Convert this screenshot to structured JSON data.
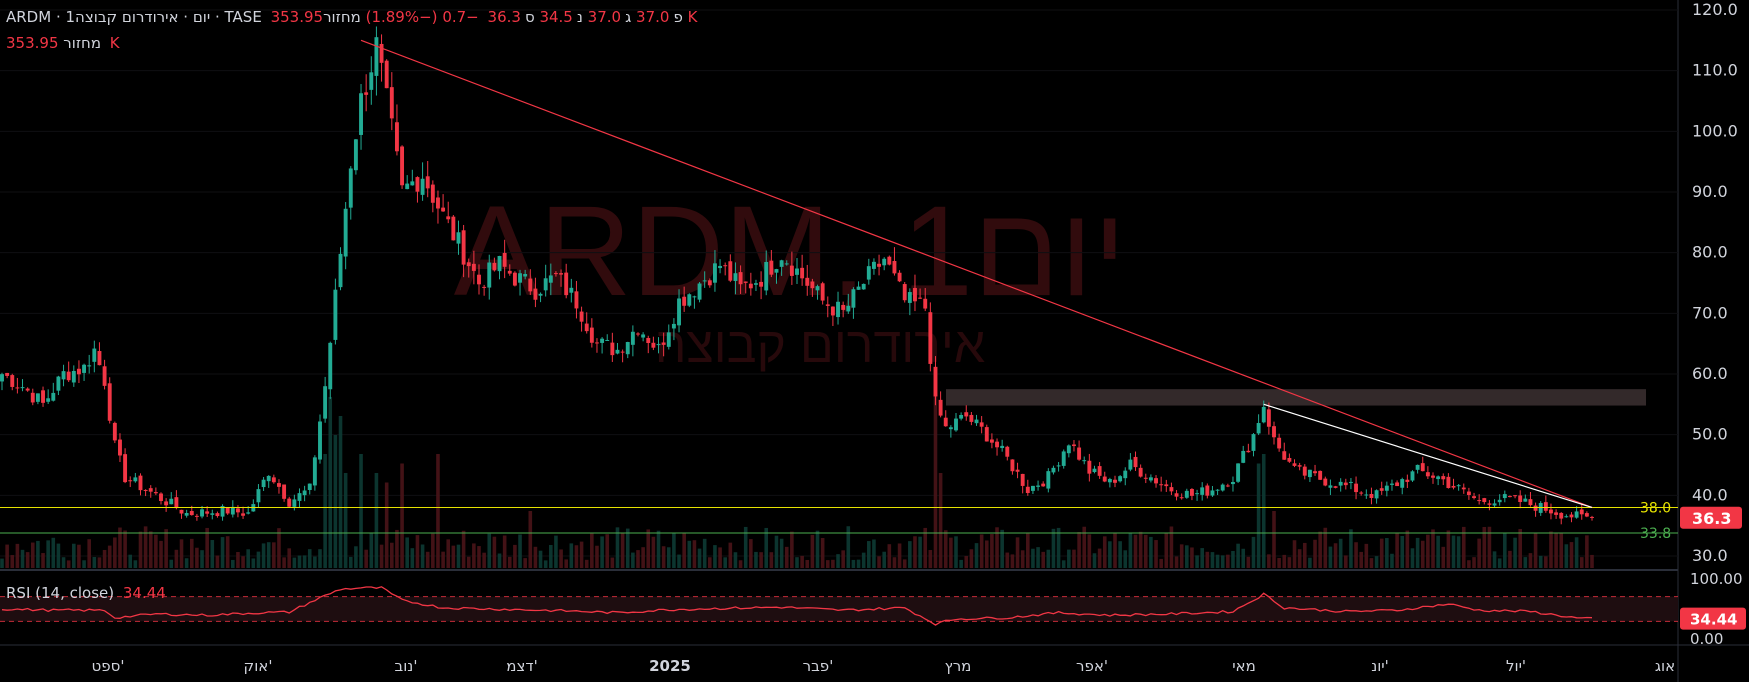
{
  "legend": {
    "symbol_text": "ARDM · 1יום · אירודרום קבוצה · TASE",
    "o_label": "פ",
    "o_value": "37.0",
    "h_label": "ג",
    "h_value": "37.0",
    "l_label": "נ",
    "l_value": "34.5",
    "c_label": "ס",
    "c_value": "36.3",
    "change": "−0.7 (−1.89%)",
    "vol_label": "מחזור",
    "vol_value": "353.95 K"
  },
  "volume_legend": {
    "label": "מחזור",
    "value": "353.95 K"
  },
  "rsi_legend": {
    "label": "RSI (14, close)",
    "value": "34.44"
  },
  "watermark": {
    "line1": "ARDM, 1יום",
    "line2": "אירודרום קבוצה"
  },
  "colors": {
    "up": "#22ab94",
    "down": "#f23645",
    "yellow_line": "#e6e300",
    "green_line": "#4caf50",
    "rsi": "#f23645"
  },
  "chart_data": {
    "type": "candlestick",
    "price_axis": {
      "min": 30,
      "max": 120,
      "ticks": [
        "120.0",
        "110.0",
        "100.0",
        "90.0",
        "80.0",
        "70.0",
        "60.0",
        "50.0",
        "40.0",
        "30.0"
      ]
    },
    "time_axis": {
      "labels": [
        "ספט'",
        "אוק'",
        "נוב'",
        "דצמ'",
        "2025",
        "פבר'",
        "מרץ",
        "אפר'",
        "מאי",
        "יונ'",
        "יול'",
        "אוג"
      ]
    },
    "horizontal_lines": [
      {
        "value": 38.0,
        "label": "38.0",
        "color": "#e6e300"
      },
      {
        "value": 33.8,
        "label": "33.8",
        "color": "#4caf50"
      }
    ],
    "last_price": {
      "value": 36.3,
      "label": "36.3"
    },
    "resistance_zone": {
      "from": 54.8,
      "to": 57.5
    },
    "trendlines": [
      {
        "from": {
          "index": 70,
          "price": 115
        },
        "to": {
          "index": 310,
          "price": 38
        }
      },
      {
        "from": {
          "index": 246,
          "price": 55
        },
        "to": {
          "index": 310,
          "price": 38
        }
      }
    ],
    "anchors": [
      [
        0,
        60
      ],
      [
        4,
        58
      ],
      [
        8,
        55
      ],
      [
        12,
        60
      ],
      [
        16,
        61
      ],
      [
        18,
        64
      ],
      [
        20,
        59
      ],
      [
        22,
        48
      ],
      [
        24,
        43
      ],
      [
        30,
        40
      ],
      [
        36,
        37
      ],
      [
        44,
        37.5
      ],
      [
        48,
        37
      ],
      [
        52,
        44
      ],
      [
        56,
        39
      ],
      [
        60,
        41
      ],
      [
        63,
        58
      ],
      [
        66,
        80
      ],
      [
        68,
        95
      ],
      [
        70,
        105
      ],
      [
        73,
        114
      ],
      [
        76,
        100
      ],
      [
        78,
        90
      ],
      [
        82,
        93
      ],
      [
        86,
        86
      ],
      [
        90,
        80
      ],
      [
        93,
        75
      ],
      [
        97,
        78
      ],
      [
        100,
        76
      ],
      [
        104,
        74
      ],
      [
        108,
        76
      ],
      [
        112,
        72
      ],
      [
        116,
        65
      ],
      [
        120,
        64
      ],
      [
        124,
        68
      ],
      [
        128,
        64
      ],
      [
        132,
        72
      ],
      [
        136,
        75
      ],
      [
        140,
        78
      ],
      [
        144,
        74
      ],
      [
        148,
        76
      ],
      [
        152,
        80
      ],
      [
        156,
        76
      ],
      [
        160,
        72
      ],
      [
        164,
        70
      ],
      [
        168,
        75
      ],
      [
        172,
        79
      ],
      [
        176,
        72
      ],
      [
        180,
        71
      ],
      [
        182,
        55
      ],
      [
        184,
        51
      ],
      [
        188,
        53
      ],
      [
        192,
        50
      ],
      [
        196,
        46
      ],
      [
        200,
        41
      ],
      [
        204,
        43
      ],
      [
        208,
        49
      ],
      [
        212,
        44
      ],
      [
        216,
        42
      ],
      [
        220,
        45
      ],
      [
        224,
        43
      ],
      [
        228,
        41
      ],
      [
        232,
        40
      ],
      [
        236,
        41
      ],
      [
        240,
        43
      ],
      [
        244,
        50
      ],
      [
        246,
        55
      ],
      [
        248,
        49
      ],
      [
        252,
        44
      ],
      [
        256,
        43
      ],
      [
        260,
        42
      ],
      [
        264,
        41
      ],
      [
        268,
        40
      ],
      [
        272,
        42
      ],
      [
        276,
        44
      ],
      [
        280,
        43
      ],
      [
        284,
        41
      ],
      [
        288,
        39
      ],
      [
        292,
        39.5
      ],
      [
        296,
        39
      ],
      [
        300,
        38
      ],
      [
        304,
        37
      ],
      [
        308,
        36.3
      ]
    ],
    "volume_spikes": [
      [
        63,
        0.6
      ],
      [
        64,
        0.9
      ],
      [
        65,
        0.7
      ],
      [
        66,
        0.8
      ],
      [
        67,
        0.5
      ],
      [
        70,
        0.6
      ],
      [
        73,
        0.5
      ],
      [
        75,
        0.45
      ],
      [
        78,
        0.55
      ],
      [
        85,
        0.6
      ],
      [
        103,
        0.3
      ],
      [
        182,
        1.0
      ],
      [
        183,
        0.5
      ],
      [
        245,
        0.55
      ],
      [
        246,
        0.6
      ],
      [
        248,
        0.3
      ]
    ],
    "rsi": {
      "axis": {
        "min": 0,
        "max": 100,
        "ticks": [
          "100.00",
          "0.00"
        ]
      },
      "upper_band": 70,
      "lower_band": 30,
      "anchors": [
        [
          0,
          50
        ],
        [
          10,
          48
        ],
        [
          20,
          48
        ],
        [
          22,
          36
        ],
        [
          30,
          42
        ],
        [
          40,
          40
        ],
        [
          50,
          44
        ],
        [
          56,
          45
        ],
        [
          62,
          68
        ],
        [
          66,
          82
        ],
        [
          70,
          84
        ],
        [
          74,
          84
        ],
        [
          78,
          64
        ],
        [
          86,
          52
        ],
        [
          96,
          50
        ],
        [
          110,
          47
        ],
        [
          120,
          44
        ],
        [
          130,
          49
        ],
        [
          140,
          51
        ],
        [
          152,
          53
        ],
        [
          164,
          48
        ],
        [
          176,
          52
        ],
        [
          182,
          26
        ],
        [
          186,
          34
        ],
        [
          196,
          36
        ],
        [
          206,
          44
        ],
        [
          216,
          40
        ],
        [
          228,
          42
        ],
        [
          240,
          46
        ],
        [
          246,
          74
        ],
        [
          250,
          52
        ],
        [
          262,
          46
        ],
        [
          272,
          48
        ],
        [
          282,
          58
        ],
        [
          288,
          48
        ],
        [
          298,
          46
        ],
        [
          308,
          34.44
        ]
      ],
      "last": {
        "value": 34.44,
        "label": "34.44"
      }
    }
  }
}
